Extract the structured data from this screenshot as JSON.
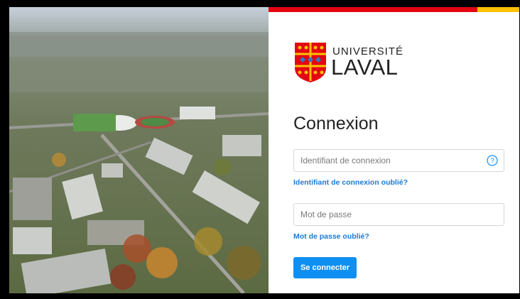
{
  "theme": {
    "brand_red": "#e30513",
    "brand_gold": "#ffc103",
    "link_color": "#1a7bd6",
    "button_color": "#0f8ff2"
  },
  "branding": {
    "line1": "UNIVERSITÉ",
    "line2": "LAVAL"
  },
  "login": {
    "title": "Connexion",
    "username_placeholder": "Identifiant de connexion",
    "username_value": "",
    "help_icon": "question-circle-icon",
    "forgot_username": "Identifiant de connexion oublié?",
    "password_placeholder": "Mot de passe",
    "password_value": "",
    "forgot_password": "Mot de passe oublié?",
    "submit_label": "Se connecter"
  },
  "background_image": "aerial-campus-photo"
}
